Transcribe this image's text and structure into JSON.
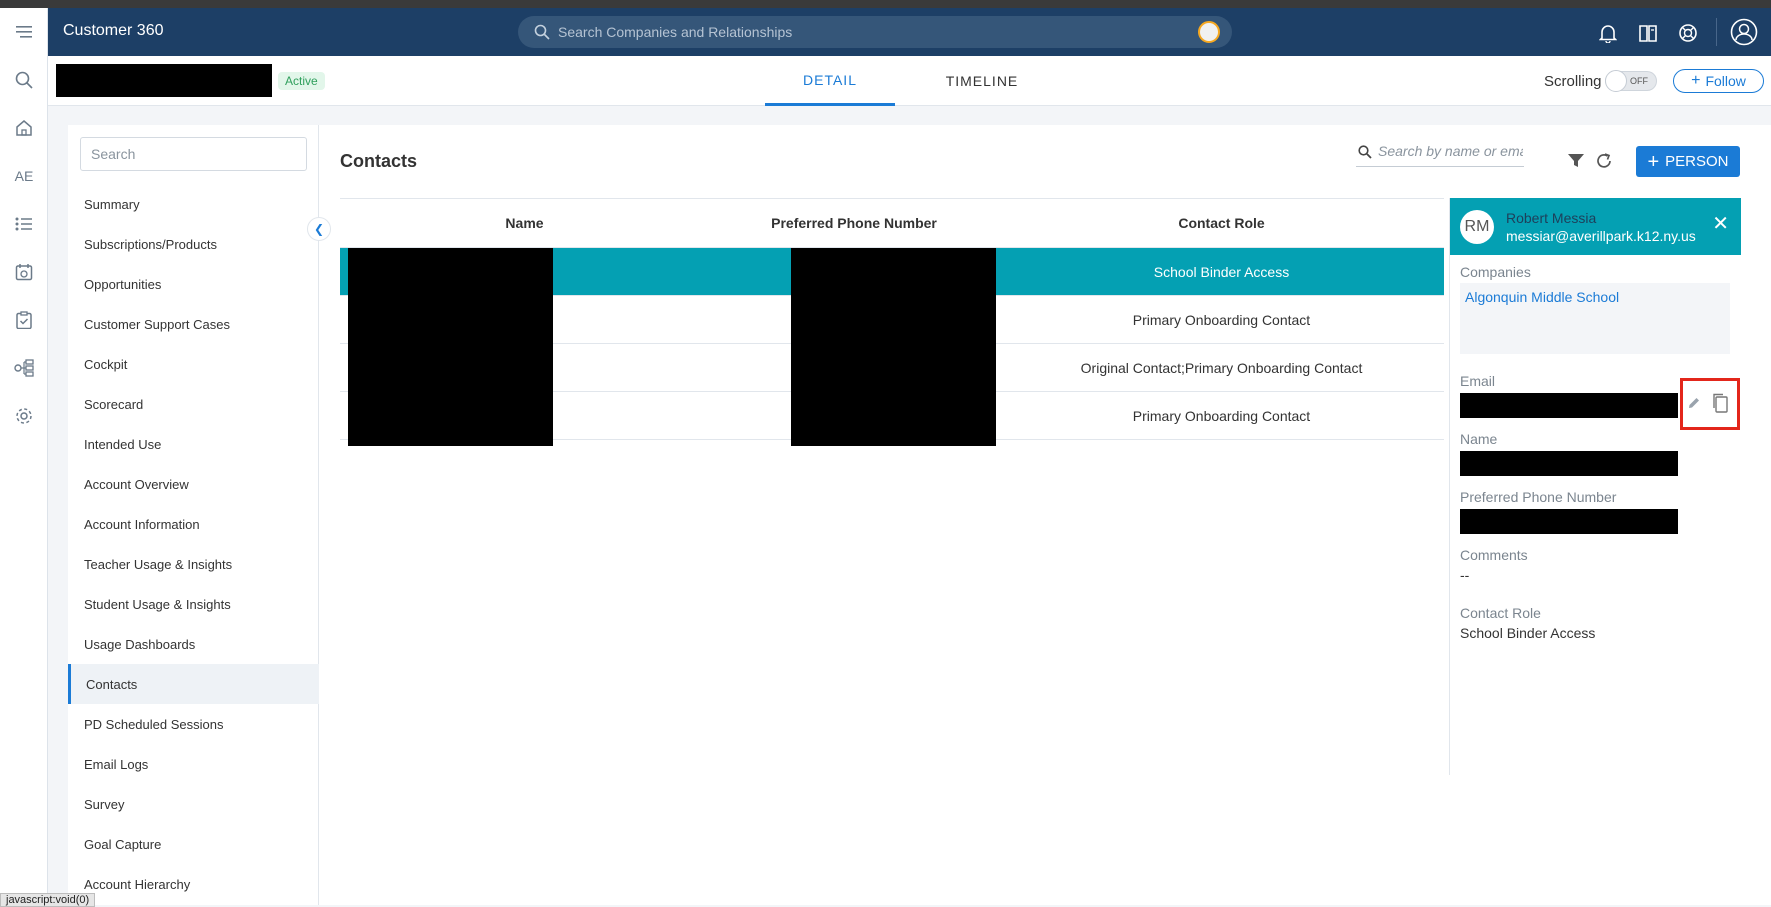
{
  "app": {
    "title": "Customer 360"
  },
  "global_search": {
    "placeholder": "Search Companies and Relationships"
  },
  "rail": {
    "ae_label": "AE"
  },
  "header": {
    "status": "Active"
  },
  "tabs": [
    {
      "label": "DETAIL"
    },
    {
      "label": "TIMELINE"
    }
  ],
  "scrolling": {
    "label": "Scrolling",
    "toggle_label": "OFF"
  },
  "follow": {
    "label": "Follow"
  },
  "sidebar": {
    "search_placeholder": "Search",
    "items": [
      {
        "label": "Summary"
      },
      {
        "label": "Subscriptions/Products"
      },
      {
        "label": "Opportunities"
      },
      {
        "label": "Customer Support Cases"
      },
      {
        "label": "Cockpit"
      },
      {
        "label": "Scorecard"
      },
      {
        "label": "Intended Use"
      },
      {
        "label": "Account Overview"
      },
      {
        "label": "Account Information"
      },
      {
        "label": "Teacher Usage & Insights"
      },
      {
        "label": "Student Usage & Insights"
      },
      {
        "label": "Usage Dashboards"
      },
      {
        "label": "Contacts"
      },
      {
        "label": "PD Scheduled Sessions"
      },
      {
        "label": "Email Logs"
      },
      {
        "label": "Survey"
      },
      {
        "label": "Goal Capture"
      },
      {
        "label": "Account Hierarchy"
      }
    ]
  },
  "contacts": {
    "title": "Contacts",
    "search_placeholder": "Search by name or email",
    "add_person_label": "PERSON",
    "columns": [
      "Name",
      "Preferred Phone Number",
      "Contact Role"
    ],
    "rows": [
      {
        "role": "School Binder Access"
      },
      {
        "role": "Primary Onboarding Contact"
      },
      {
        "role": "Original Contact;Primary Onboarding Contact"
      },
      {
        "role": "Primary Onboarding Contact"
      }
    ]
  },
  "detail": {
    "initials": "RM",
    "name": "Robert Messia",
    "email": "messiar@averillpark.k12.ny.us",
    "companies_label": "Companies",
    "company": "Algonquin Middle School",
    "email_label": "Email",
    "name_label": "Name",
    "phone_label": "Preferred Phone Number",
    "comments_label": "Comments",
    "comments_value": "--",
    "role_label": "Contact Role",
    "role_value": "School Binder Access"
  },
  "status_bar": {
    "tip": "javascript:void(0)"
  }
}
